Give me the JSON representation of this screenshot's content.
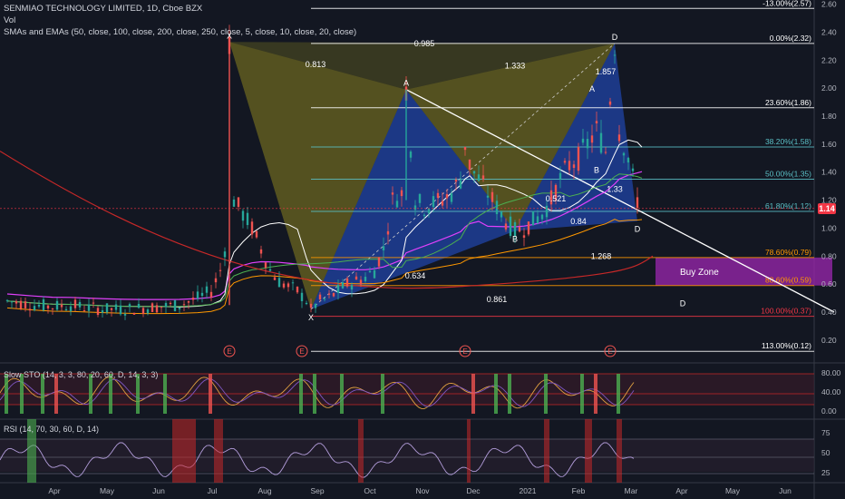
{
  "header": {
    "title": "SENMIAO TECHNOLOGY LIMITED, 1D, Cboe BZX",
    "vol": "Vol",
    "mas": "SMAs and EMAs (50, close, 100, close, 200, close, 250, close, 5, close, 10, close, 20, close)"
  },
  "colors": {
    "background": "#131722",
    "bullish": "#26a69a",
    "bearish": "#ef5350",
    "pattern_yellow": "#a59a1f",
    "pattern_blue": "#2962ff",
    "buy_zone": "#9c27b0",
    "current_price": "#f23645"
  },
  "current_price": "1.14",
  "buy_zone_label": "Buy Zone",
  "chart_data": {
    "type": "line",
    "price_axis": [
      "2.60",
      "2.40",
      "2.20",
      "2.00",
      "1.80",
      "1.60",
      "1.40",
      "1.20",
      "1.00",
      "0.80",
      "0.60",
      "0.40",
      "0.20"
    ],
    "price_axis_values": [
      2.6,
      2.4,
      2.2,
      2.0,
      1.8,
      1.6,
      1.4,
      1.2,
      1.0,
      0.8,
      0.6,
      0.4,
      0.2
    ],
    "months": [
      "Apr",
      "May",
      "Jun",
      "Jul",
      "Aug",
      "Sep",
      "Oct",
      "Nov",
      "Dec",
      "2021",
      "Feb",
      "Mar",
      "Apr",
      "May",
      "Jun"
    ],
    "ylim": [
      0.05,
      2.63
    ],
    "price_path": [
      [
        0,
        0.48
      ],
      [
        6,
        0.45
      ],
      [
        10,
        0.44
      ],
      [
        14,
        0.45
      ],
      [
        18,
        0.43
      ],
      [
        22,
        0.42
      ],
      [
        26,
        0.42
      ],
      [
        30,
        0.43
      ],
      [
        34,
        0.44
      ],
      [
        38,
        0.45
      ],
      [
        42,
        0.5
      ],
      [
        45,
        0.55
      ],
      [
        47,
        0.7
      ],
      [
        48,
        0.85
      ],
      [
        49,
        2.33
      ],
      [
        50,
        1.2
      ],
      [
        52,
        1.1
      ],
      [
        54,
        1.0
      ],
      [
        56,
        0.85
      ],
      [
        58,
        0.7
      ],
      [
        60,
        0.62
      ],
      [
        62,
        0.58
      ],
      [
        64,
        0.55
      ],
      [
        66,
        0.48
      ],
      [
        67,
        0.42
      ],
      [
        69,
        0.48
      ],
      [
        71,
        0.5
      ],
      [
        73,
        0.55
      ],
      [
        75,
        0.6
      ],
      [
        77,
        0.62
      ],
      [
        79,
        0.65
      ],
      [
        81,
        0.7
      ],
      [
        83,
        0.85
      ],
      [
        85,
        1.2
      ],
      [
        87,
        1.25
      ],
      [
        88,
        1.99
      ],
      [
        90,
        1.2
      ],
      [
        92,
        1.15
      ],
      [
        94,
        1.18
      ],
      [
        96,
        1.2
      ],
      [
        98,
        1.25
      ],
      [
        100,
        1.35
      ],
      [
        101,
        1.6
      ],
      [
        102,
        1.45
      ],
      [
        104,
        1.35
      ],
      [
        106,
        1.25
      ],
      [
        108,
        1.15
      ],
      [
        110,
        1.05
      ],
      [
        112,
        0.98
      ],
      [
        114,
        1.0
      ],
      [
        116,
        1.05
      ],
      [
        118,
        1.1
      ],
      [
        120,
        1.2
      ],
      [
        122,
        1.35
      ],
      [
        124,
        1.45
      ],
      [
        126,
        1.5
      ],
      [
        128,
        1.6
      ],
      [
        130,
        1.7
      ],
      [
        132,
        1.55
      ],
      [
        134,
        2.32
      ],
      [
        135,
        1.7
      ],
      [
        137,
        1.5
      ],
      [
        139,
        1.2
      ],
      [
        140,
        1.14
      ]
    ],
    "x_index_max": 178,
    "fib_levels": [
      {
        "label": "-13.00%(2.57)",
        "value": 2.57
      },
      {
        "label": "0.00%(2.32)",
        "value": 2.32
      },
      {
        "label": "23.60%(1.86)",
        "value": 1.86
      },
      {
        "label": "38.20%(1.58)",
        "value": 1.58
      },
      {
        "label": "50.00%(1.35)",
        "value": 1.35
      },
      {
        "label": "61.80%(1.12)",
        "value": 1.12
      },
      {
        "label": "78.60%(0.79)",
        "value": 0.79
      },
      {
        "label": "88.60%(0.59)",
        "value": 0.59
      },
      {
        "label": "100.00%(0.37)",
        "value": 0.37
      },
      {
        "label": "113.00%(0.12)",
        "value": 0.12
      }
    ],
    "pattern_points": [
      {
        "label": "X",
        "x": 49,
        "y": 2.33
      },
      {
        "label": "X",
        "x": 67,
        "y": 0.42
      },
      {
        "label": "A",
        "x": 88,
        "y": 1.99
      },
      {
        "label": "B",
        "x": 112,
        "y": 0.98
      },
      {
        "label": "D",
        "x": 134,
        "y": 2.32
      },
      {
        "label": "A",
        "x": 129,
        "y": 1.95
      },
      {
        "label": "B",
        "x": 130,
        "y": 1.37
      },
      {
        "label": "D",
        "x": 139,
        "y": 1.05
      },
      {
        "label": "D",
        "x": 149,
        "y": 0.52
      }
    ],
    "ratio_labels": [
      {
        "label": "0.985",
        "x": 92,
        "y": 2.3
      },
      {
        "label": "0.813",
        "x": 68,
        "y": 2.15
      },
      {
        "label": "1.333",
        "x": 112,
        "y": 2.14
      },
      {
        "label": "1.857",
        "x": 132,
        "y": 2.1
      },
      {
        "label": "0.521",
        "x": 121,
        "y": 1.19
      },
      {
        "label": "1.33",
        "x": 134,
        "y": 1.26
      },
      {
        "label": "0.84",
        "x": 126,
        "y": 1.03
      },
      {
        "label": "1.268",
        "x": 131,
        "y": 0.78
      },
      {
        "label": "0.634",
        "x": 90,
        "y": 0.64
      },
      {
        "label": "0.861",
        "x": 108,
        "y": 0.47
      }
    ],
    "earnings_markers": [
      49,
      65,
      101,
      133
    ],
    "stoch_label": "Slow STO (14, 3, 3, 80, 20, 60, D, 14, 3, 3)",
    "stoch_axis": [
      "80.00",
      "40.00",
      "0.00"
    ],
    "rsi_label": "RSI (14, 70, 30, 60, D, 14)",
    "rsi_axis": [
      "75",
      "50",
      "25"
    ]
  }
}
